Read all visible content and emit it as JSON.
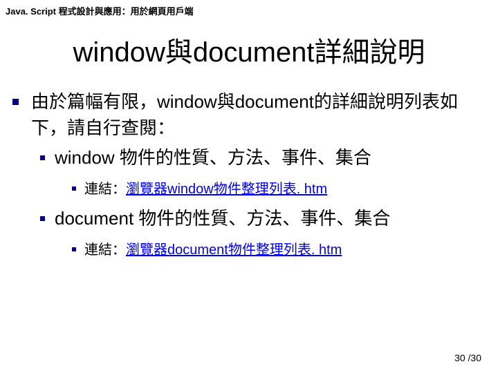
{
  "header": "Java. Script 程式設計與應用：用於網頁用戶端",
  "title": "window與document詳細說明",
  "bullet1": "由於篇幅有限，window與document的詳細說明列表如下，請自行查閱：",
  "bullet2a": "window 物件的性質、方法、事件、集合",
  "bullet3a_prefix": "連結：",
  "bullet3a_link": "瀏覽器window物件整理列表. htm",
  "bullet2b": "document 物件的性質、方法、事件、集合",
  "bullet3b_prefix": "連結：",
  "bullet3b_link": "瀏覽器document物件整理列表. htm",
  "page_current": "30",
  "page_sep": " /",
  "page_total": "30"
}
